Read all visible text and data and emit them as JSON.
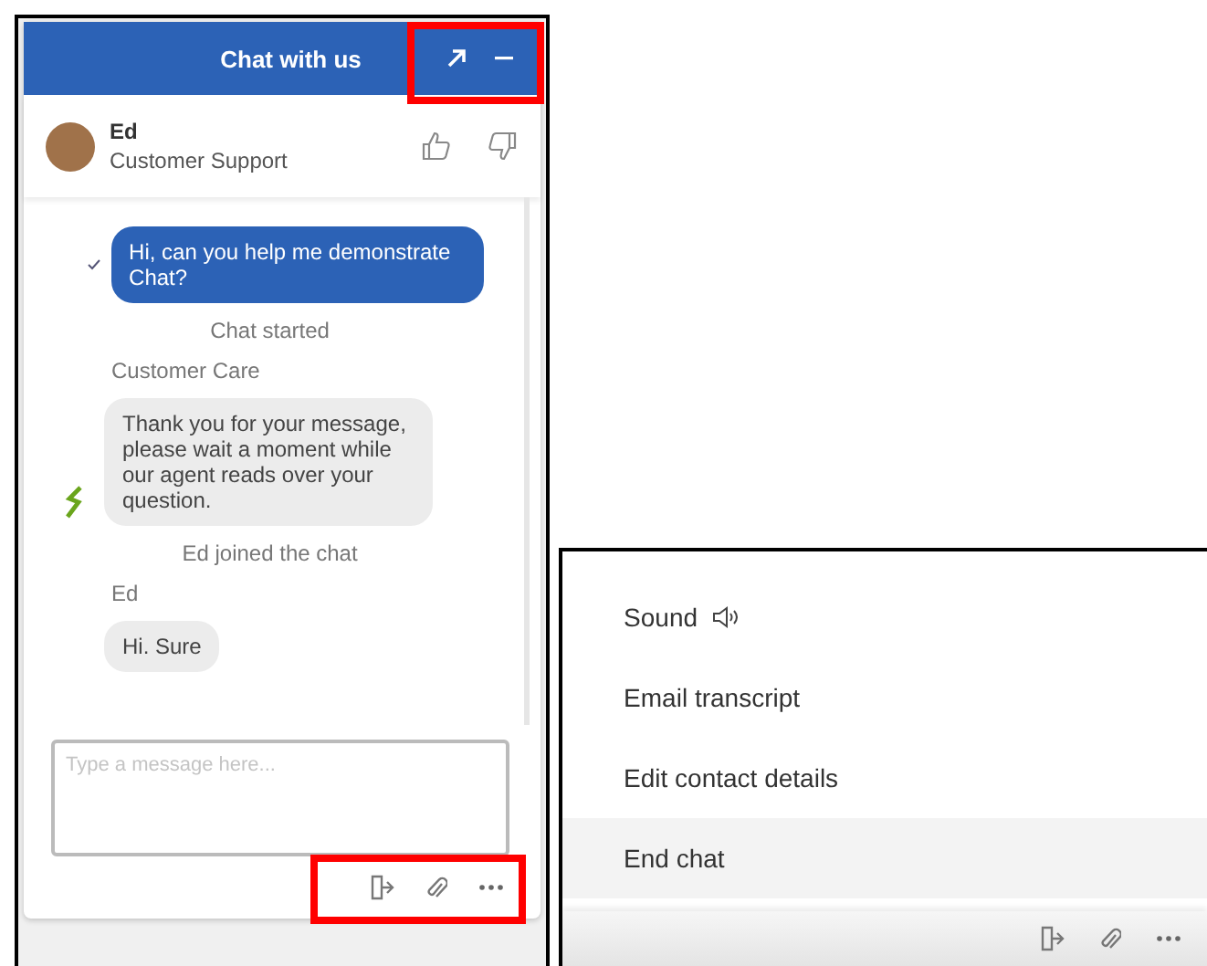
{
  "header": {
    "title": "Chat with us"
  },
  "agent": {
    "name": "Ed",
    "role": "Customer Support"
  },
  "messages": [
    {
      "kind": "outgoing",
      "text": "Hi, can you help me demonstrate Chat?",
      "delivered": true
    },
    {
      "kind": "system",
      "text": "Chat started"
    },
    {
      "kind": "sender",
      "text": "Customer Care"
    },
    {
      "kind": "incoming",
      "text": "Thank you for your message, please wait a moment while our agent reads over your question.",
      "avatar": true
    },
    {
      "kind": "system",
      "text": "Ed joined the chat"
    },
    {
      "kind": "sender",
      "text": "Ed"
    },
    {
      "kind": "incoming",
      "text": "Hi. Sure",
      "avatar": false
    }
  ],
  "composer": {
    "placeholder": "Type a message here..."
  },
  "menu": {
    "items": [
      {
        "label": "Sound",
        "kind": "sound",
        "selected": false
      },
      {
        "label": "Email transcript",
        "kind": "plain",
        "selected": false
      },
      {
        "label": "Edit contact details",
        "kind": "plain",
        "selected": false
      },
      {
        "label": "End chat",
        "kind": "plain",
        "selected": true
      }
    ]
  }
}
